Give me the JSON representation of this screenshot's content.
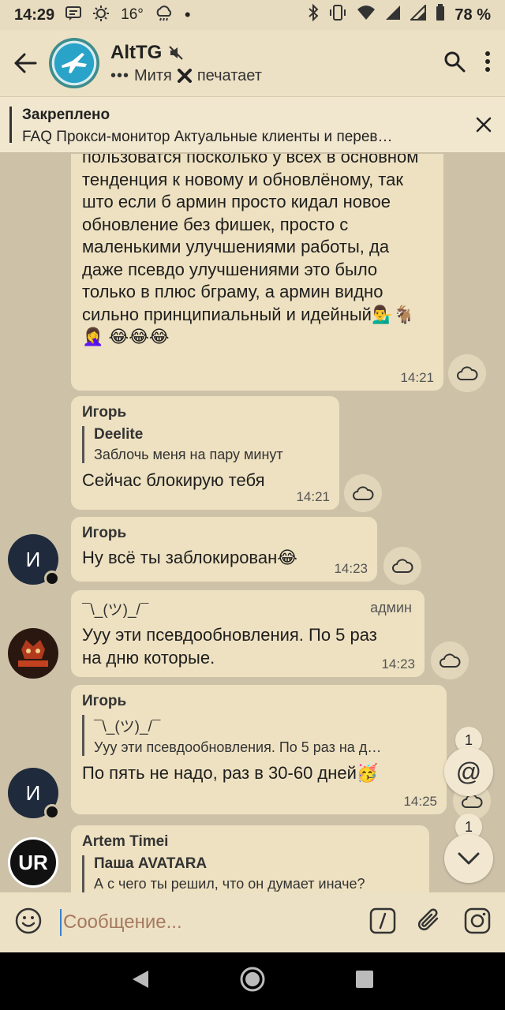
{
  "status_bar": {
    "time": "14:29",
    "temperature": "16°",
    "battery": "78 %"
  },
  "header": {
    "title": "AltTG",
    "typing_user": "Митя",
    "typing_action": "печатает"
  },
  "pinned": {
    "label": "Закреплено",
    "text": "FAQ  Прокси-монитор  Актуальные клиенты и перев…"
  },
  "messages": [
    {
      "text": "пользоватся посколько у всех в основном тенденция к новому и обновлёному, так што если б армин просто кидал новое обновление без фишек, просто с маленькими улучшениями работы, да даже псевдо улучшениями это было только в плюс бграму, а армин видно сильно принципиальный и идейный💁‍♂️🐐🤦‍♀️ 😂😂😂",
      "time": "14:21"
    },
    {
      "sender": "Игорь",
      "reply_name": "Deelite",
      "reply_text": "Заблочь меня на пару минут",
      "text": "Сейчас блокирую тебя",
      "time": "14:21"
    },
    {
      "sender": "Игорь",
      "text": "Ну всё ты заблокирован😂",
      "time": "14:23",
      "avatar_letter": "И"
    },
    {
      "sender": "¯\\_(ツ)_/¯",
      "tag": "админ",
      "text": "Ууу эти псевдообновления. По 5 раз на дню которые.",
      "time": "14:23"
    },
    {
      "sender": "Игорь",
      "reply_name": "¯\\_(ツ)_/¯",
      "reply_text": "Ууу эти псевдообновления. По 5 раз на д…",
      "text": "По пять не надо, раз в 30-60 дней🥳",
      "time": "14:25",
      "avatar_letter": "И"
    },
    {
      "sender": "Artem Timei",
      "reply_name": "Паша AVATARA",
      "reply_text": "А с чего ты решил, что он думает иначе?",
      "avatar_letters": "UR"
    }
  ],
  "badges": {
    "mentions_count": "1",
    "scroll_count": "1"
  },
  "input": {
    "placeholder": "Сообщение..."
  },
  "icons": {
    "back": "arrow-left-icon",
    "search": "search-icon",
    "menu": "more-vertical-icon",
    "close": "close-icon",
    "share": "cloud-icon",
    "emoji": "emoji-icon",
    "commands": "slash-command-icon",
    "attach": "paperclip-icon",
    "camera": "instagram-camera-icon"
  }
}
